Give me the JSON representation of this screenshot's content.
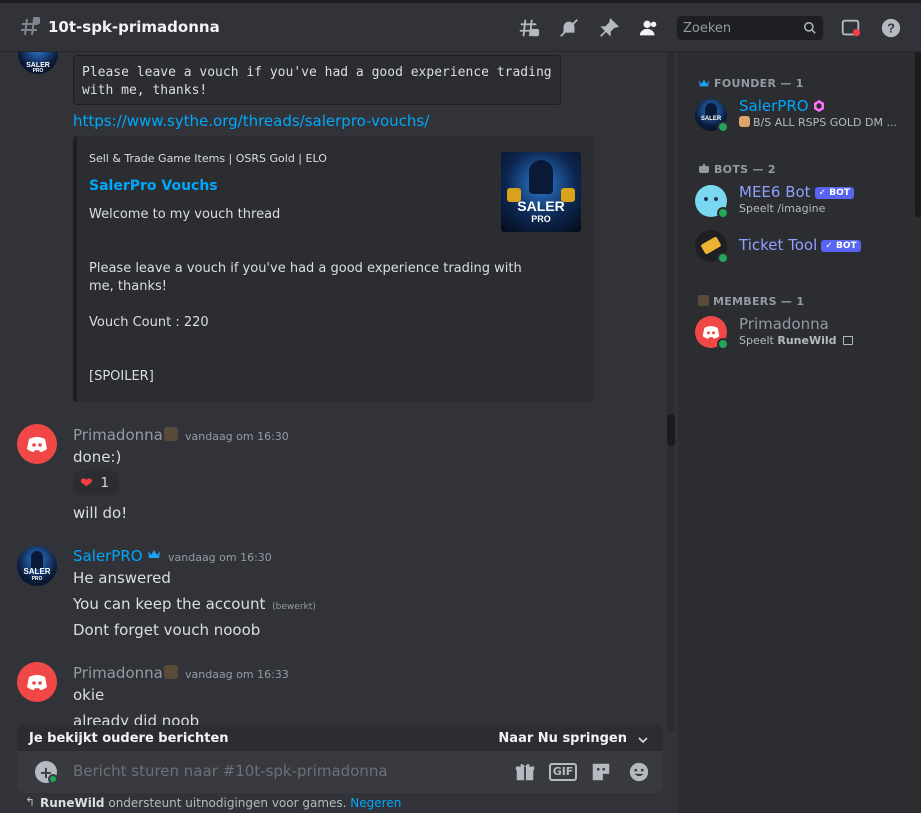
{
  "channel": {
    "name": "10t-spk-primadonna"
  },
  "search": {
    "placeholder": "Zoeken"
  },
  "messages": {
    "m0": {
      "code_line1": "Please leave a vouch if you've had a good experience trading",
      "code_line2": "with me, thanks!",
      "link": "https://www.sythe.org/threads/salerpro-vouchs/",
      "embed": {
        "provider": "Sell & Trade Game Items | OSRS Gold | ELO",
        "title": "SalerPro Vouchs",
        "line1": "Welcome to my vouch thread",
        "line2": "Please leave a vouch if you've had a good experience trading with",
        "line3": "me, thanks!",
        "line4": "Vouch Count : 220",
        "line5": "[SPOILER]",
        "thumb_text1": "SALER",
        "thumb_text2": "PRO"
      }
    },
    "m1": {
      "author": "Primadonna",
      "time": "vandaag om 16:30",
      "line1": "done:)",
      "reaction_count": "1",
      "line2": "will do!"
    },
    "m2": {
      "author": "SalerPRO",
      "time": "vandaag om 16:30",
      "line1": "He answered",
      "line2": "You can keep the account",
      "edited": "(bewerkt)",
      "line3": "Dont forget vouch nooob"
    },
    "m3": {
      "author": "Primadonna",
      "time": "vandaag om 16:33",
      "line1": "okie",
      "line2": "already did noob"
    }
  },
  "banner": {
    "text": "Je bekijkt oudere berichten",
    "jump": "Naar Nu springen"
  },
  "composer": {
    "placeholder": "Bericht sturen naar #10t-spk-primadonna",
    "gif": "GIF"
  },
  "notice": {
    "game": "RuneWild",
    "text": " ondersteunt uitnodigingen voor games. ",
    "dismiss": "Negeren"
  },
  "members": {
    "founder_header": "FOUNDER — 1",
    "bots_header": "BOTS — 2",
    "members_header": "MEMBERS — 1",
    "salerpro": {
      "name": "SalerPRO",
      "status": "B/S ALL RSPS GOLD DM ..."
    },
    "mee6": {
      "name": "MEE6 Bot",
      "badge": "BOT",
      "status": "Speelt /imagine"
    },
    "ticket": {
      "name": "Ticket Tool",
      "badge": "BOT"
    },
    "primadonna": {
      "name": "Primadonna",
      "status_prefix": "Speelt ",
      "status_game": "RuneWild"
    }
  },
  "colors": {
    "accent_blue": "#00a8fc",
    "bot_badge": "#5865f2",
    "online": "#23a55a",
    "discord_red": "#f04747"
  }
}
